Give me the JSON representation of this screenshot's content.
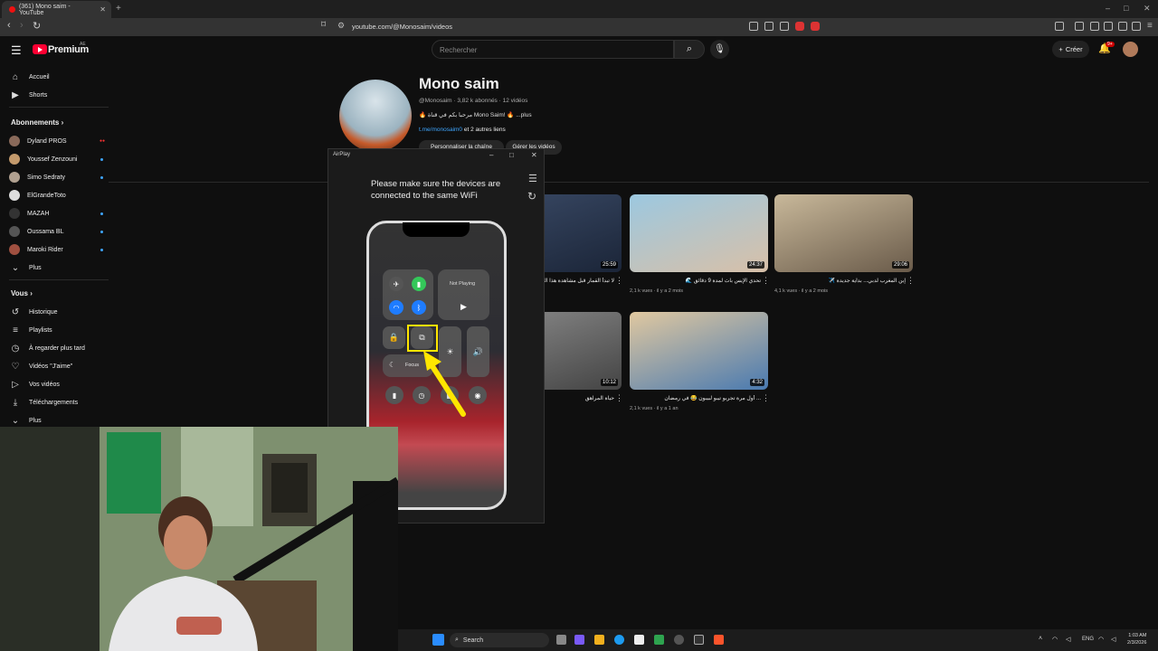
{
  "browser": {
    "tab_title": "(361) Mono saim - YouTube",
    "url": "youtube.com/@Monosaim/videos",
    "new_tab": "+",
    "window_controls": [
      "–",
      "□",
      "✕"
    ]
  },
  "header": {
    "logo_text": "Premium",
    "logo_sup": "AE",
    "search_placeholder": "Rechercher",
    "create_label": "Créer",
    "notif_badge": "9+"
  },
  "sidebar": {
    "main": [
      {
        "label": "Accueil",
        "icon": "home-icon"
      },
      {
        "label": "Shorts",
        "icon": "shorts-icon"
      }
    ],
    "subs_title": "Abonnements",
    "subs": [
      {
        "label": "Dyland PROS",
        "status": "live",
        "color": "#8a6a5a"
      },
      {
        "label": "Youssef Zenzouni",
        "status": "dot",
        "color": "#c49a6c"
      },
      {
        "label": "Simo Sedraty",
        "status": "dot",
        "color": "#b0a090"
      },
      {
        "label": "ElGrandeToto",
        "status": "",
        "color": "#ddd"
      },
      {
        "label": "MAZAH",
        "status": "dot",
        "color": "#333"
      },
      {
        "label": "Oussama BL",
        "status": "dot",
        "color": "#555"
      },
      {
        "label": "Maroki Rider",
        "status": "dot",
        "color": "#a05040"
      }
    ],
    "subs_more": "Plus",
    "you_title": "Vous",
    "you": [
      {
        "label": "Historique",
        "icon": "history-icon"
      },
      {
        "label": "Playlists",
        "icon": "playlists-icon"
      },
      {
        "label": "À regarder plus tard",
        "icon": "watch-later-icon"
      },
      {
        "label": "Vidéos \"J'aime\"",
        "icon": "like-icon"
      },
      {
        "label": "Vos vidéos",
        "icon": "your-videos-icon"
      },
      {
        "label": "Téléchargements",
        "icon": "download-icon"
      },
      {
        "label": "Plus",
        "icon": "chevron-down-icon"
      }
    ]
  },
  "channel": {
    "name": "Mono saim",
    "meta": "@Monosaim · 3,82 k abonnés · 12 vidéos",
    "desc": "🔥 مرحبا بكم في قناة Mono Saim! 🔥 ...plus",
    "link": "t.me/monosaim0",
    "link_suffix": " et 2 autres liens",
    "btn_customize": "Personnaliser la chaîne",
    "btn_manage": "Gérer les vidéos"
  },
  "videos": [
    {
      "title": "لا تبدأ القمار قبل مشاهدة هذا الفيديو",
      "meta": "",
      "duration": "25:59",
      "colors": [
        "#3a4a66",
        "#1b2538"
      ]
    },
    {
      "title": "🌊 تحدي الإيس باث لمدة 9 دقائق",
      "meta": "2,1 k vues · il y a 2 mois",
      "duration": "24:37",
      "colors": [
        "#9cc8e0",
        "#d8c0a8"
      ]
    },
    {
      "title": "✈️ إبن المغرب لدبي... بداية جديدة",
      "meta": "4,1 k vues · il y a 2 mois",
      "duration": "29:06",
      "colors": [
        "#c8b89a",
        "#6a5b4a"
      ]
    },
    {
      "title": "حياة المراهق",
      "meta": "",
      "duration": "10:12",
      "colors": [
        "#8a8a8a",
        "#444"
      ]
    },
    {
      "title": "أول مرة تجربو تيبو لبيبون 😂 في رمضان ...",
      "meta": "2,1 k vues · il y a 1 an",
      "duration": "4:32",
      "colors": [
        "#e0c8a0",
        "#4a7ab0"
      ]
    }
  ],
  "airplay": {
    "title": "AirPlay",
    "message": "Please make sure the devices are connected to the same WiFi",
    "now_playing": "Not Playing",
    "focus": "Focus"
  },
  "taskbar": {
    "search": "Search",
    "lang": "ENG",
    "time": "1:03 AM",
    "date": "2/3/2026"
  }
}
